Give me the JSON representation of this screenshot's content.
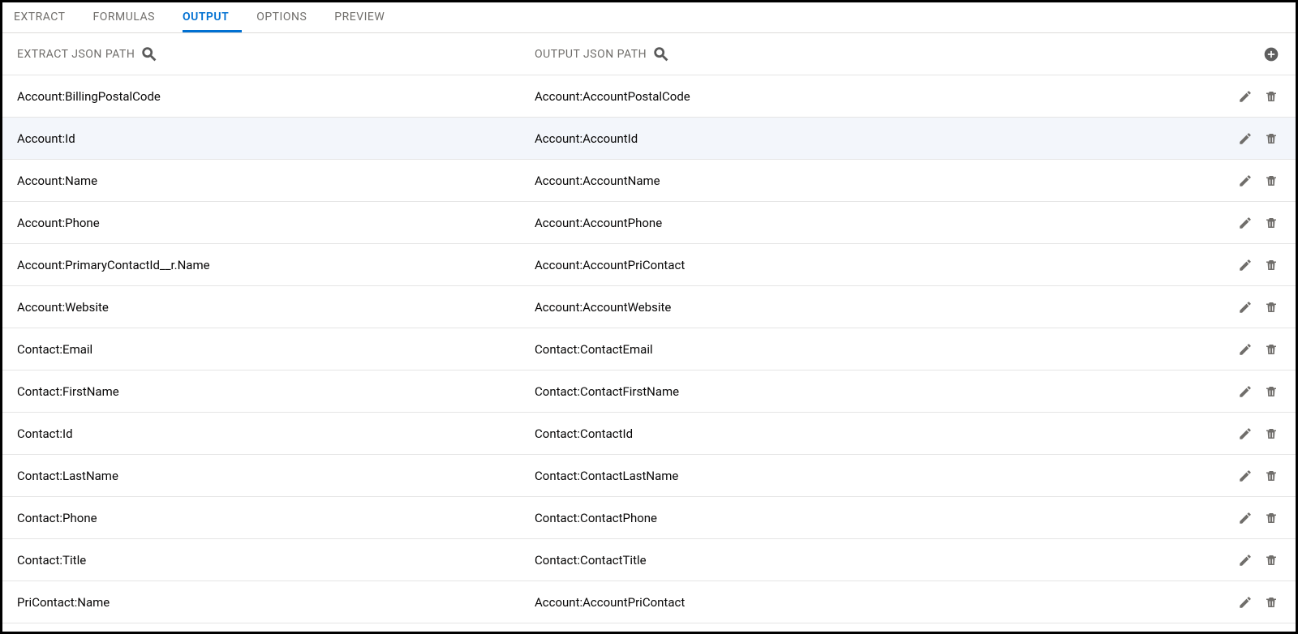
{
  "tabs": [
    {
      "label": "EXTRACT",
      "active": false
    },
    {
      "label": "FORMULAS",
      "active": false
    },
    {
      "label": "OUTPUT",
      "active": true
    },
    {
      "label": "OPTIONS",
      "active": false
    },
    {
      "label": "PREVIEW",
      "active": false
    }
  ],
  "columns": {
    "extract_label": "EXTRACT JSON PATH",
    "output_label": "OUTPUT JSON PATH"
  },
  "rows": [
    {
      "extract": "Account:BillingPostalCode",
      "output": "Account:AccountPostalCode",
      "highlight": false
    },
    {
      "extract": "Account:Id",
      "output": "Account:AccountId",
      "highlight": true
    },
    {
      "extract": "Account:Name",
      "output": "Account:AccountName",
      "highlight": false
    },
    {
      "extract": "Account:Phone",
      "output": "Account:AccountPhone",
      "highlight": false
    },
    {
      "extract": "Account:PrimaryContactId__r.Name",
      "output": "Account:AccountPriContact",
      "highlight": false
    },
    {
      "extract": "Account:Website",
      "output": "Account:AccountWebsite",
      "highlight": false
    },
    {
      "extract": "Contact:Email",
      "output": "Contact:ContactEmail",
      "highlight": false
    },
    {
      "extract": "Contact:FirstName",
      "output": "Contact:ContactFirstName",
      "highlight": false
    },
    {
      "extract": "Contact:Id",
      "output": "Contact:ContactId",
      "highlight": false
    },
    {
      "extract": "Contact:LastName",
      "output": "Contact:ContactLastName",
      "highlight": false
    },
    {
      "extract": "Contact:Phone",
      "output": "Contact:ContactPhone",
      "highlight": false
    },
    {
      "extract": "Contact:Title",
      "output": "Contact:ContactTitle",
      "highlight": false
    },
    {
      "extract": "PriContact:Name",
      "output": "Account:AccountPriContact",
      "highlight": false
    }
  ],
  "icons": {
    "search": "search-icon",
    "add": "add-icon",
    "edit": "pencil-icon",
    "delete": "trash-icon"
  }
}
